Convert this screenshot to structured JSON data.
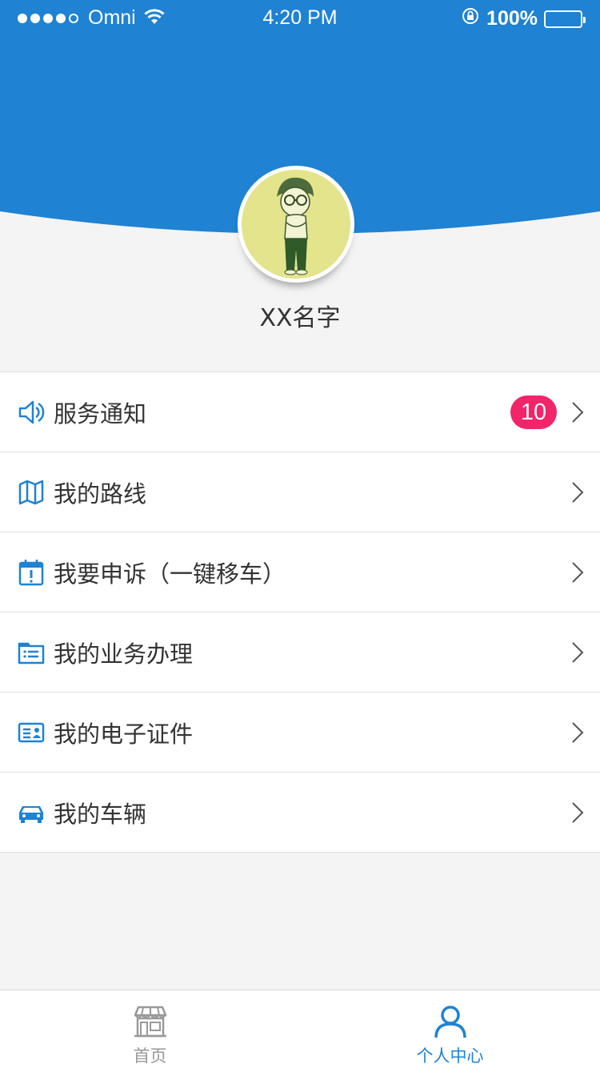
{
  "status_bar": {
    "carrier": "Omni",
    "time": "4:20 PM",
    "battery": "100%"
  },
  "colors": {
    "brand_blue": "#1f82d2",
    "badge_pink": "#f2246a",
    "avatar_bg": "#e3e48c"
  },
  "profile": {
    "name": "XX名字"
  },
  "menu": [
    {
      "icon": "speaker-icon",
      "label": "服务通知",
      "badge": "10"
    },
    {
      "icon": "map-icon",
      "label": "我的路线"
    },
    {
      "icon": "calendar-alert-icon",
      "label": "我要申诉（一键移车）"
    },
    {
      "icon": "folder-list-icon",
      "label": "我的业务办理"
    },
    {
      "icon": "id-card-icon",
      "label": "我的电子证件"
    },
    {
      "icon": "car-icon",
      "label": "我的车辆"
    }
  ],
  "tab_bar": {
    "tabs": [
      {
        "icon": "storefront-icon",
        "label": "首页",
        "active": false
      },
      {
        "icon": "person-icon",
        "label": "个人中心",
        "active": true
      }
    ]
  }
}
